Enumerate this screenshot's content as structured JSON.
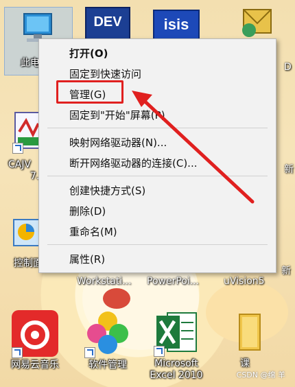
{
  "desktop": {
    "icons": [
      {
        "label": "此电",
        "icon": "this-pc-icon"
      },
      {
        "label": "CAJV",
        "sublabel": "7.",
        "icon": "cajviewer-icon"
      },
      {
        "label": "控制面板",
        "icon": "control-panel-icon"
      },
      {
        "label": "网易云音乐",
        "icon": "netease-music-icon"
      },
      {
        "label": "软件管理",
        "icon": "software-manager-icon"
      },
      {
        "label": "Microsoft",
        "sublabel": "Excel 2010",
        "icon": "excel-icon"
      },
      {
        "label": "课",
        "icon": "folder-icon"
      },
      {
        "label": "Workstati...",
        "icon": "workstation-icon"
      },
      {
        "label": "PowerPoi...",
        "icon": "powerpoint-icon"
      },
      {
        "label": "uVision5",
        "icon": "uvision-icon"
      },
      {
        "label": "DEV",
        "icon": "dev-icon"
      },
      {
        "label": "isis",
        "icon": "isis-icon"
      },
      {
        "label": "新",
        "icon": "new-icon"
      },
      {
        "label": "新",
        "icon": "new-icon-2"
      },
      {
        "label": "D",
        "icon": "d-icon"
      }
    ]
  },
  "context_menu": {
    "items": [
      {
        "label": "打开(O)",
        "bold": true
      },
      {
        "label": "固定到快速访问"
      },
      {
        "label": "管理(G)",
        "highlighted": true
      },
      {
        "label": "固定到\"开始\"屏幕(P)"
      },
      {
        "label": "映射网络驱动器(N)..."
      },
      {
        "label": "断开网络驱动器的连接(C)..."
      },
      {
        "label": "创建快捷方式(S)"
      },
      {
        "label": "删除(D)"
      },
      {
        "label": "重命名(M)"
      },
      {
        "label": "属性(R)"
      }
    ]
  },
  "annotation": {
    "color": "#e0201f"
  },
  "watermark": "CSDN @绵 羊"
}
